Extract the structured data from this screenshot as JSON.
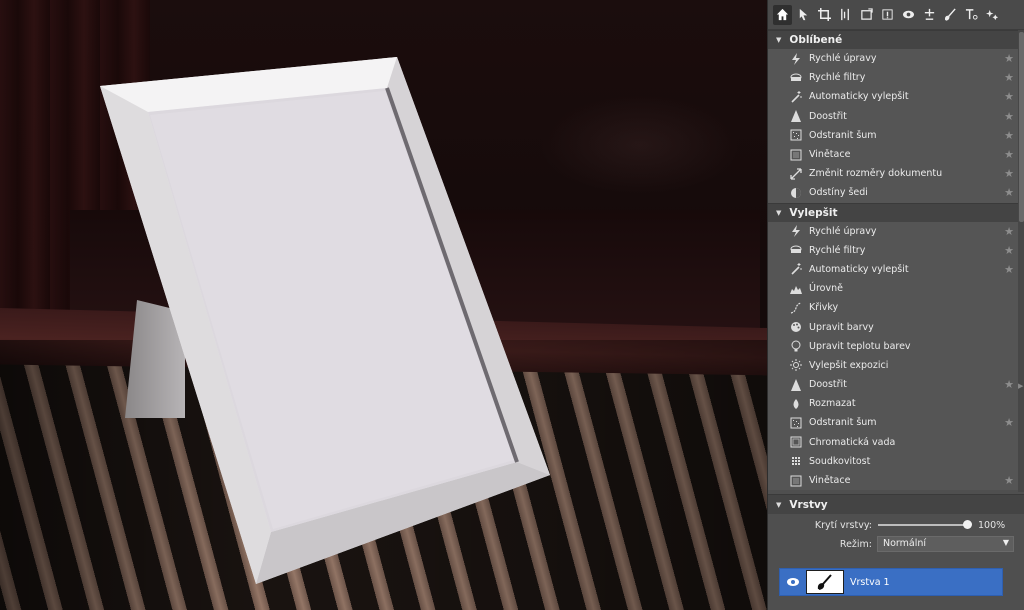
{
  "toolbar": {
    "icons": [
      "home-icon",
      "pointer-icon",
      "crop-icon",
      "straighten-icon",
      "transform-icon",
      "exposure-icon",
      "view-icon",
      "retouch-icon",
      "brush-icon",
      "text-icon",
      "effects-icon"
    ]
  },
  "sections": [
    {
      "title": "Oblíbené",
      "items": [
        {
          "label": "Rychlé úpravy",
          "icon": "lightning-icon",
          "star": true
        },
        {
          "label": "Rychlé filtry",
          "icon": "filter-icon",
          "star": true
        },
        {
          "label": "Automaticky vylepšit",
          "icon": "magic-wand-icon",
          "star": true
        },
        {
          "label": "Doostřit",
          "icon": "sharpen-icon",
          "star": true
        },
        {
          "label": "Odstranit šum",
          "icon": "noise-icon",
          "star": true
        },
        {
          "label": "Vinětace",
          "icon": "vignette-icon",
          "star": true
        },
        {
          "label": "Změnit rozměry dokumentu",
          "icon": "resize-icon",
          "star": true
        },
        {
          "label": "Odstíny šedi",
          "icon": "grayscale-icon",
          "star": true
        }
      ]
    },
    {
      "title": "Vylepšit",
      "items": [
        {
          "label": "Rychlé úpravy",
          "icon": "lightning-icon",
          "star": true
        },
        {
          "label": "Rychlé filtry",
          "icon": "filter-icon",
          "star": true
        },
        {
          "label": "Automaticky vylepšit",
          "icon": "magic-wand-icon",
          "star": true
        },
        {
          "label": "Úrovně",
          "icon": "levels-icon",
          "star": false
        },
        {
          "label": "Křivky",
          "icon": "curves-icon",
          "star": false
        },
        {
          "label": "Upravit barvy",
          "icon": "palette-icon",
          "star": false
        },
        {
          "label": "Upravit teplotu barev",
          "icon": "bulb-icon",
          "star": false
        },
        {
          "label": "Vylepšit expozici",
          "icon": "sun-icon",
          "star": false
        },
        {
          "label": "Doostřit",
          "icon": "sharpen-icon",
          "star": true
        },
        {
          "label": "Rozmazat",
          "icon": "drop-icon",
          "star": false
        },
        {
          "label": "Odstranit šum",
          "icon": "noise-icon",
          "star": true
        },
        {
          "label": "Chromatická vada",
          "icon": "chromatic-icon",
          "star": false
        },
        {
          "label": "Soudkovitost",
          "icon": "barrel-icon",
          "star": false
        },
        {
          "label": "Vinětace",
          "icon": "vignette-icon",
          "star": true
        }
      ]
    }
  ],
  "layers": {
    "title": "Vrstvy",
    "opacity_label": "Krytí vrstvy:",
    "opacity_value": "100%",
    "opacity": 1.0,
    "mode_label": "Režim:",
    "mode_value": "Normální",
    "layer_name": "Vrstva 1"
  },
  "colors": {
    "panel": "#4f4f4f",
    "selection": "#3a6fc4"
  }
}
